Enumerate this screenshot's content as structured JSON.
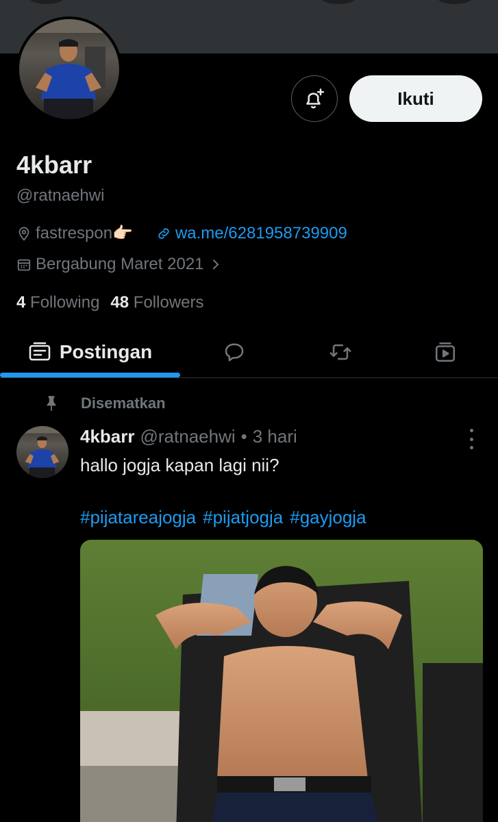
{
  "profile": {
    "follow_label": "Ikuti",
    "display_name": "4kbarr",
    "handle": "@ratnaehwi",
    "location": "fastrespon👉🏻",
    "website": "wa.me/6281958739909",
    "joined": "Bergabung Maret 2021",
    "following_count": "4",
    "following_label": "Following",
    "followers_count": "48",
    "followers_label": "Followers"
  },
  "tabs": {
    "active_label": "Postingan",
    "icons": [
      "posts-icon",
      "replies-icon",
      "reposts-icon",
      "media-icon"
    ]
  },
  "post": {
    "pinned_label": "Disematkan",
    "author_name": "4kbarr",
    "author_handle": "@ratnaehwi",
    "separator": "•",
    "time": "3 hari",
    "text": "hallo jogja kapan lagi nii?",
    "hashtags": [
      "#pijatareajogja",
      "#pijatjogja",
      "#gayjogja"
    ]
  },
  "colors": {
    "background": "#000000",
    "accent": "#1d9bf0",
    "text_primary": "#e7e9ea",
    "text_secondary": "#71767b",
    "button_bg": "#eff3f4",
    "divider": "#2f3336"
  }
}
